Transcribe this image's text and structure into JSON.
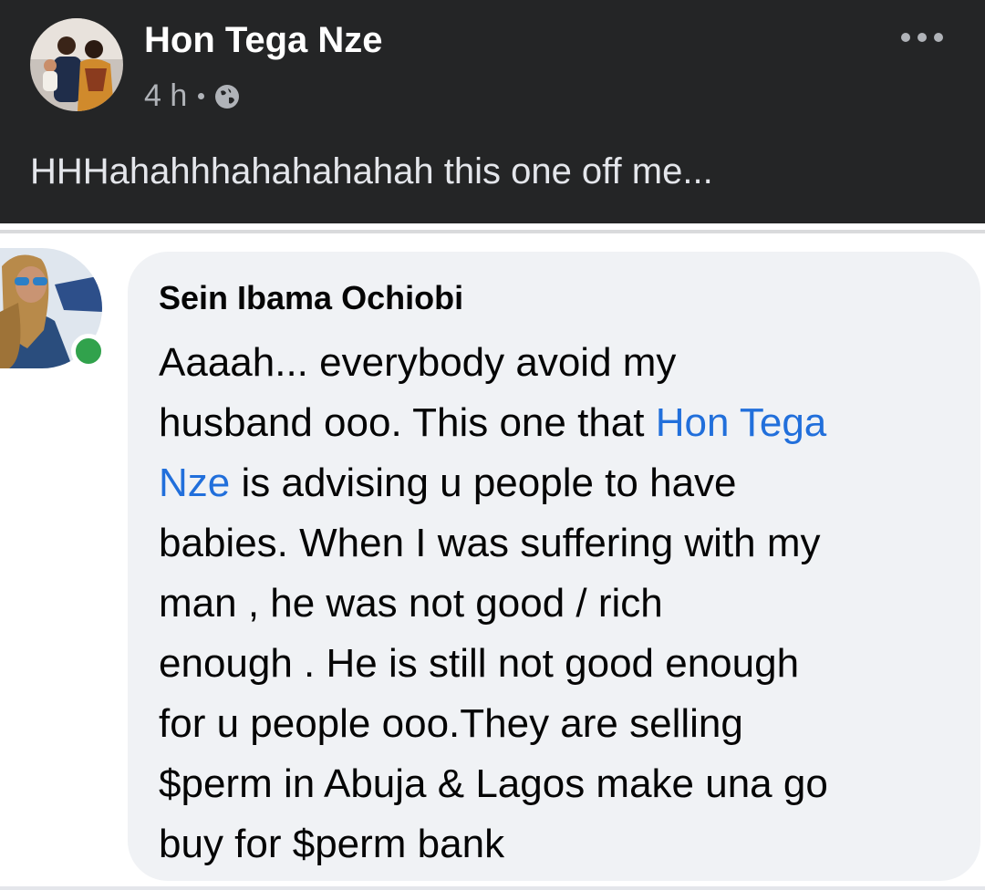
{
  "post": {
    "author": "Hon Tega Nze",
    "time": "4 h",
    "text": "HHHahahhhahahahahah this one off me..."
  },
  "comment": {
    "author": "Sein Ibama Ochiobi",
    "lines": {
      "l1": "Aaaah... everybody avoid my",
      "l2a": "husband ooo. This one that ",
      "l2b": "Hon Tega",
      "l3a": "Nze",
      "l3b": " is advising u people to have",
      "l4": "babies. When I was suffering with my",
      "l5": "man , he was not good / rich",
      "l6": "enough . He is still not good enough",
      "l7": "for u people ooo.They are selling",
      "l8": "$perm in Abuja & Lagos make una go",
      "l9": "buy for $perm bank"
    }
  },
  "colors": {
    "header_bg": "#242526",
    "bubble_bg": "#f0f2f5",
    "mention": "#216fdb",
    "online": "#31a24c"
  },
  "icons": {
    "privacy": "globe-icon",
    "menu": "more-options-icon"
  }
}
